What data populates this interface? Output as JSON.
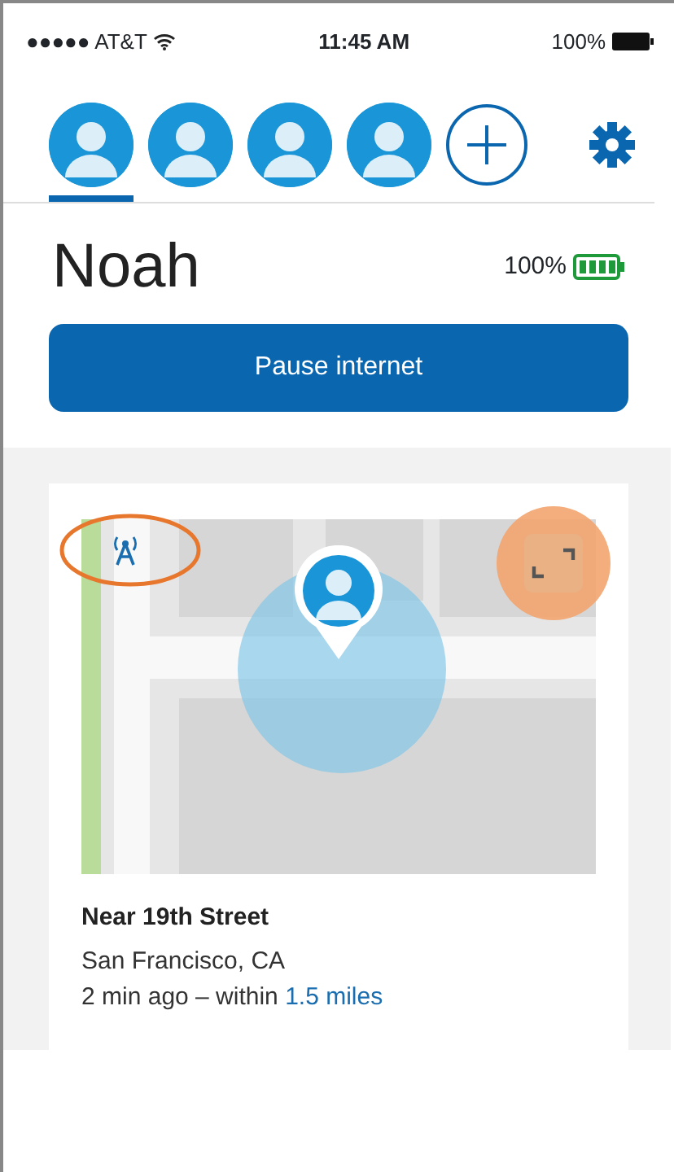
{
  "status_bar": {
    "carrier": "●●●●● AT&T",
    "time": "11:45 AM",
    "battery": "100%"
  },
  "profiles": [
    {
      "selected": true
    },
    {
      "selected": false
    },
    {
      "selected": false
    },
    {
      "selected": false
    }
  ],
  "profile": {
    "name": "Noah",
    "device_battery": "100%"
  },
  "pause_button": "Pause internet",
  "location_card": {
    "title": "Near 19th Street",
    "city": "San Francisco, CA",
    "detail": "2 min ago – within",
    "distance_link": "1.5 miles"
  }
}
